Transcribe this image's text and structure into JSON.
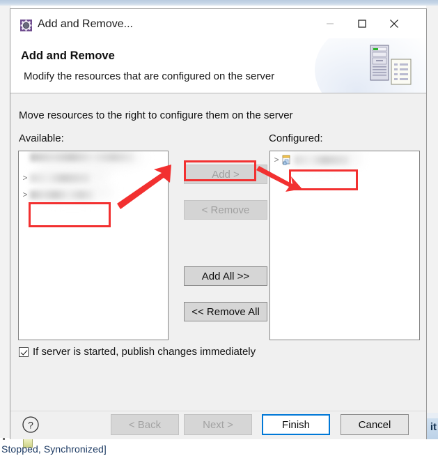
{
  "window": {
    "title": "Add and Remove...",
    "icon": "gear-icon",
    "controls": {
      "minimize": "minimize-icon",
      "maximize": "maximize-icon",
      "close": "close-icon"
    }
  },
  "banner": {
    "title": "Add and Remove",
    "subtitle": "Modify the resources that are configured on the server",
    "image": "server-and-document-icon"
  },
  "body": {
    "instruction": "Move resources to the right to configure them on the server",
    "available": {
      "label": "Available:",
      "items": [
        {
          "expander": ">",
          "label": "",
          "redacted": true
        },
        {
          "expander": ">",
          "label": "",
          "redacted": true
        }
      ]
    },
    "configured": {
      "label": "Configured:",
      "items": [
        {
          "expander": ">",
          "label": "",
          "redacted": true,
          "icon": "project-icon"
        }
      ]
    },
    "transfer_buttons": [
      {
        "label": "Add >",
        "enabled": false,
        "name": "add-button"
      },
      {
        "label": "< Remove",
        "enabled": false,
        "name": "remove-button"
      },
      {
        "label": "Add All >>",
        "enabled": true,
        "name": "add-all-button"
      },
      {
        "label": "<< Remove All",
        "enabled": true,
        "name": "remove-all-button"
      }
    ],
    "publish_checkbox": {
      "label": "If server is started, publish changes immediately",
      "checked": true
    }
  },
  "footer": {
    "help": "help-icon",
    "buttons": [
      {
        "label": "< Back",
        "enabled": false,
        "primary": false,
        "name": "back-button"
      },
      {
        "label": "Next >",
        "enabled": false,
        "primary": false,
        "name": "next-button"
      },
      {
        "label": "Finish",
        "enabled": true,
        "primary": true,
        "name": "finish-button"
      },
      {
        "label": "Cancel",
        "enabled": true,
        "primary": false,
        "name": "cancel-button"
      }
    ]
  },
  "background": {
    "status_text": "Stopped, Synchronized]",
    "right_tab_text": "it"
  },
  "annotations": {
    "color": "#f23030",
    "highlight_rects": [
      {
        "name": "available-empty-highlight"
      },
      {
        "name": "add-button-highlight"
      },
      {
        "name": "configured-empty-highlight"
      }
    ],
    "arrows": [
      {
        "name": "arrow-to-add-button",
        "direction": "up-right"
      },
      {
        "name": "arrow-to-configured-list",
        "direction": "down-right"
      }
    ]
  }
}
